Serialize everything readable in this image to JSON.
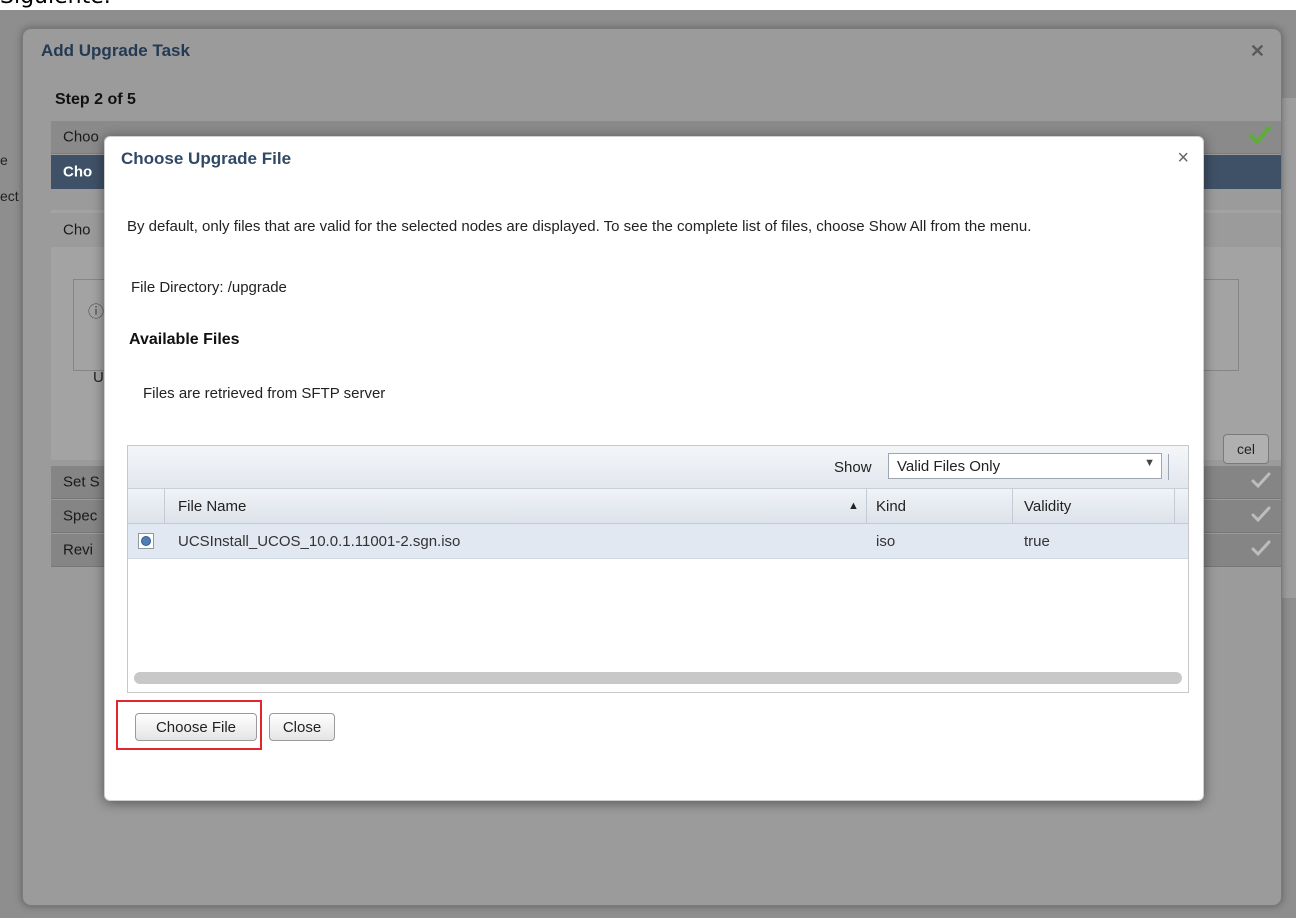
{
  "page_fragment": "Siguiente.",
  "left_clipped": [
    "e",
    "ect"
  ],
  "outer_dialog": {
    "title": "Add Upgrade Task",
    "step": "Step 2 of 5",
    "rows": [
      {
        "label": "Choo",
        "state": "done"
      },
      {
        "label": "Cho",
        "state": "active"
      },
      {
        "label": "Cho",
        "state": "plain"
      },
      {
        "label": "U",
        "state": "panel"
      },
      {
        "label": "Set S",
        "state": "pending"
      },
      {
        "label": "Spec",
        "state": "pending"
      },
      {
        "label": "Revi",
        "state": "pending"
      }
    ],
    "cancel_fragment": "cel",
    "close_icon": "close-icon",
    "check_icon": "checkmark-icon"
  },
  "inner_dialog": {
    "title": "Choose Upgrade File",
    "description": "By default, only files that are valid for the selected nodes are displayed. To see the complete list of files, choose Show All from the menu.",
    "file_directory_label": "File Directory:",
    "file_directory": "/upgrade",
    "available_files_heading": "Available Files",
    "retrieved_note": "Files are retrieved from SFTP server",
    "show_label": "Show",
    "show_selected": "Valid Files Only",
    "columns": [
      "File Name",
      "Kind",
      "Validity"
    ],
    "sort_column": "File Name",
    "files": [
      {
        "name": "UCSInstall_UCOS_10.0.1.11001-2.sgn.iso",
        "kind": "iso",
        "validity": "true",
        "selected": true
      }
    ],
    "buttons": {
      "choose": "Choose File",
      "close": "Close"
    },
    "highlight_color": "#e3262d"
  }
}
